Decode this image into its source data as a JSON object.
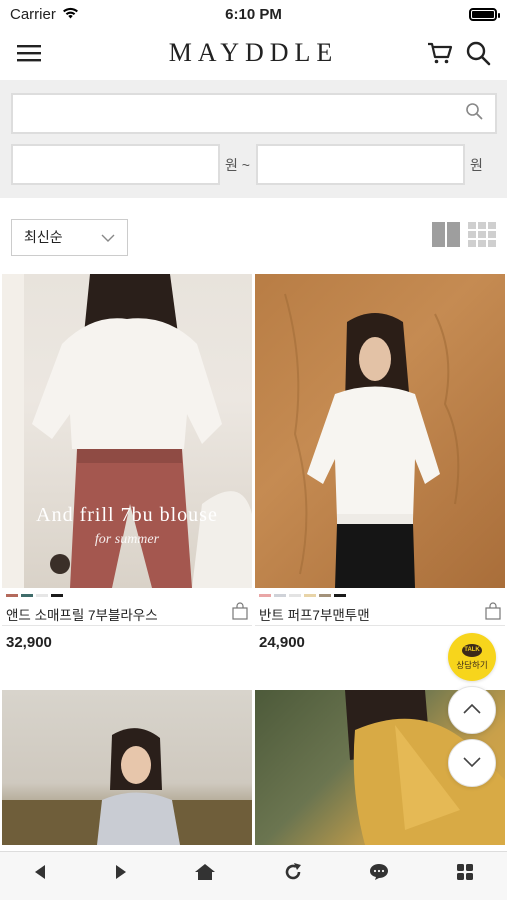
{
  "status": {
    "carrier": "Carrier",
    "time": "6:10 PM"
  },
  "header": {
    "logo": "MAYDDLE"
  },
  "search": {
    "placeholder": "",
    "price_unit_from": "원 ~",
    "price_unit_to": "원"
  },
  "sort": {
    "selected": "최신순"
  },
  "products": [
    {
      "name": "앤드 소매프릴 7부블라우스",
      "price": "32,900",
      "overlay_title": "And frill 7bu blouse",
      "overlay_sub": "for summer",
      "swatches": [
        "#b46a5c",
        "#3f6c6a",
        "#e6e6e6",
        "#1a1a1a"
      ]
    },
    {
      "name": "반트 퍼프7부맨투맨",
      "price": "24,900",
      "swatches": [
        "#e9a6a6",
        "#cfd2d8",
        "#e3e3e3",
        "#e8d4a8",
        "#a3927a",
        "#1a1a1a"
      ]
    },
    {
      "name": "",
      "price": ""
    },
    {
      "name": "",
      "price": ""
    }
  ],
  "floating": {
    "talk_bubble": "TALK",
    "talk_label": "상담하기"
  },
  "colors": {
    "accent_talk": "#f7d51c",
    "search_bg": "#efefef"
  }
}
